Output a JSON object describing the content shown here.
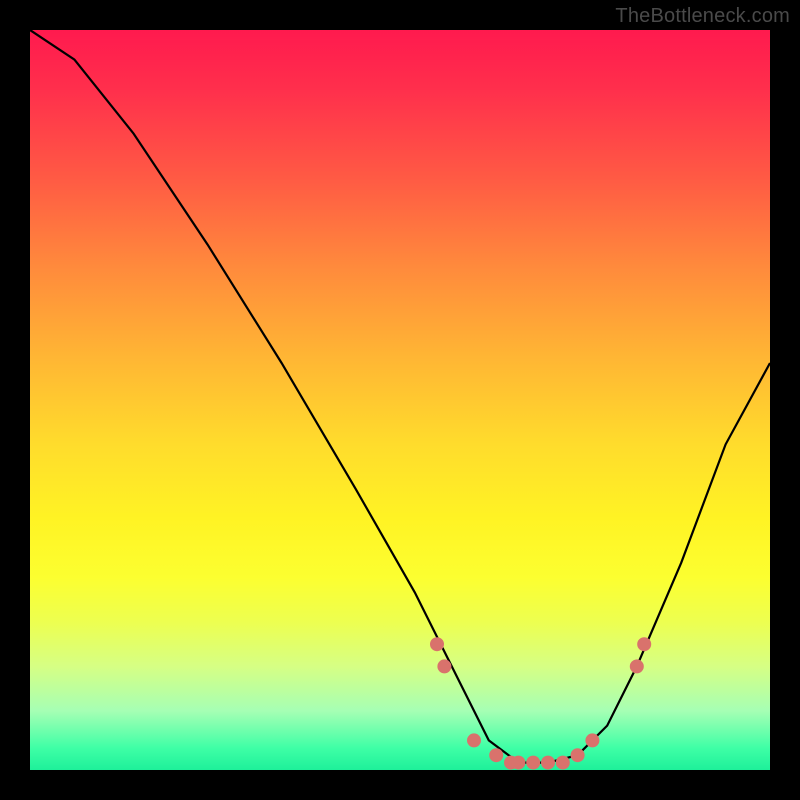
{
  "watermark": "TheBottleneck.com",
  "chart_data": {
    "type": "line",
    "title": "",
    "xlabel": "",
    "ylabel": "",
    "xlim": [
      0,
      100
    ],
    "ylim": [
      0,
      100
    ],
    "grid": false,
    "legend": false,
    "background_gradient": [
      "#ff1a4e",
      "#ffdc2c",
      "#1ef09a"
    ],
    "series": [
      {
        "name": "bottleneck-curve",
        "color": "#000000",
        "x": [
          0,
          6,
          14,
          24,
          34,
          44,
          52,
          58,
          62,
          66,
          70,
          74,
          78,
          82,
          88,
          94,
          100
        ],
        "y": [
          100,
          96,
          86,
          71,
          55,
          38,
          24,
          12,
          4,
          1,
          1,
          2,
          6,
          14,
          28,
          44,
          55
        ]
      }
    ],
    "markers": [
      {
        "name": "highlight-dots",
        "color": "#d9726c",
        "x": [
          55,
          56,
          60,
          63,
          65,
          66,
          68,
          70,
          72,
          74,
          76,
          82,
          83
        ],
        "y": [
          17,
          14,
          4,
          2,
          1,
          1,
          1,
          1,
          1,
          2,
          4,
          14,
          17
        ]
      }
    ]
  }
}
